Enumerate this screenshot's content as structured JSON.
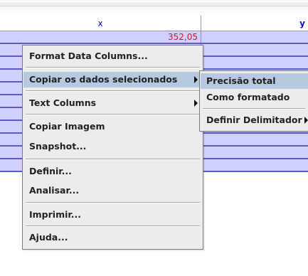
{
  "table": {
    "col_x_header": "x",
    "col_y_header": "y",
    "first_row_value": "352,05"
  },
  "context_menu": {
    "items": [
      {
        "label": "Format Data Columns...",
        "has_submenu": false
      },
      {
        "label": "Copiar os dados selecionados",
        "has_submenu": true,
        "selected": true
      },
      {
        "label": "Text Columns",
        "has_submenu": true
      },
      {
        "label": "Copiar Imagem",
        "has_submenu": false
      },
      {
        "label": "Snapshot...",
        "has_submenu": false
      },
      {
        "label": "Definir...",
        "has_submenu": false
      },
      {
        "label": "Analisar...",
        "has_submenu": false
      },
      {
        "label": "Imprimir...",
        "has_submenu": false
      },
      {
        "label": "Ajuda...",
        "has_submenu": false
      }
    ]
  },
  "submenu": {
    "items": [
      {
        "label": "Precisão total",
        "selected": true
      },
      {
        "label": "Como formatado"
      },
      {
        "label": "Definir Delimitador",
        "has_submenu": true
      }
    ]
  },
  "colors": {
    "selection_row": "#cfd0ff",
    "row_border": "#5a5acd",
    "menu_background": "#ececec",
    "menu_highlight": "#b7c9e0",
    "value_text": "#e01020",
    "header_text": "#1010d0"
  }
}
